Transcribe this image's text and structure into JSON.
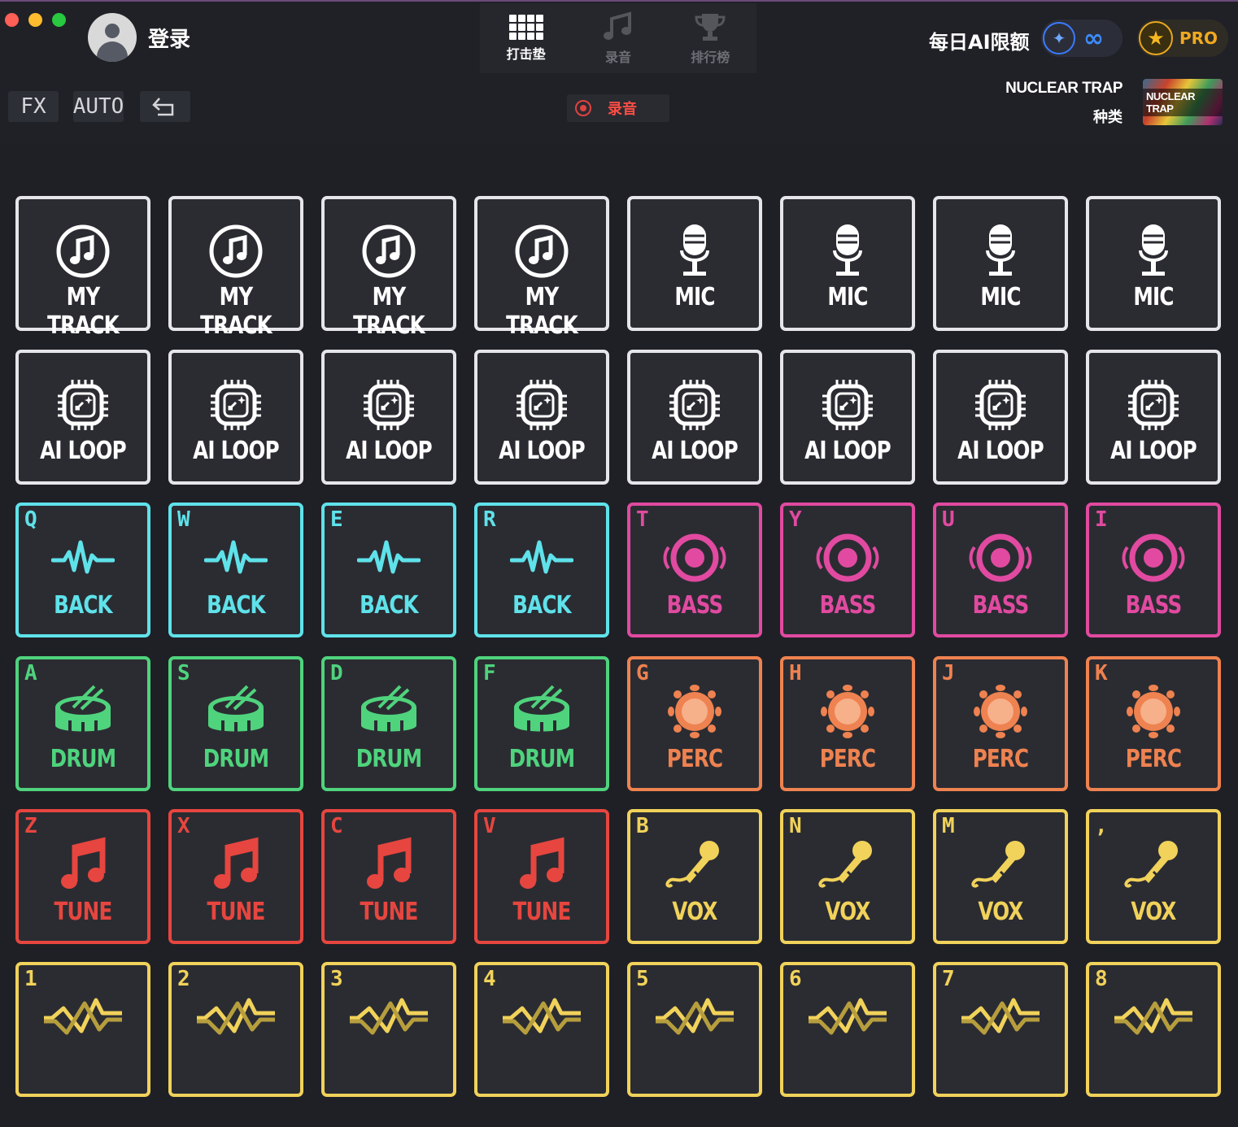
{
  "window": {
    "traffic_lights": [
      "#ff5f57",
      "#febc2e",
      "#28c840"
    ]
  },
  "user": {
    "login_label": "登录"
  },
  "nav": {
    "tabs": [
      {
        "label": "打击垫",
        "icon": "grid-icon",
        "active": true
      },
      {
        "label": "录音",
        "icon": "music-notes-icon",
        "active": false
      },
      {
        "label": "排行榜",
        "icon": "trophy-icon",
        "active": false
      }
    ]
  },
  "toolbar": {
    "fx_label": "FX",
    "auto_label": "AUTO",
    "undo_icon": "undo-icon"
  },
  "record": {
    "label": "录音"
  },
  "quota": {
    "label": "每日AI限额",
    "value": "∞"
  },
  "pro": {
    "label": "PRO"
  },
  "kit": {
    "name": "NUCLEAR TRAP",
    "type_label": "种类",
    "thumb_label": "NUCLEAR TRAP"
  },
  "colors": {
    "white": "#e6e6ea",
    "back": "#5fe2ea",
    "bass": "#e14aa0",
    "drum": "#4fd37d",
    "perc": "#ee8250",
    "tune": "#e6463f",
    "vox": "#f1d25a",
    "fx": "#f1d25a"
  },
  "rows": [
    {
      "type": "mytrack",
      "color": "white",
      "label": "MY TRACK",
      "keys": [
        "",
        "",
        "",
        "",
        "",
        "",
        "",
        ""
      ]
    },
    {
      "type": "mic",
      "color": "white",
      "label": "MIC",
      "keys": [
        "",
        "",
        "",
        "",
        "",
        "",
        "",
        ""
      ]
    },
    {
      "type": "ailoop",
      "color": "white",
      "label": "AI LOOP",
      "keys": [
        "",
        "",
        "",
        "",
        "",
        "",
        "",
        ""
      ]
    },
    {
      "type": "mixed1",
      "keys": [
        "Q",
        "W",
        "E",
        "R",
        "T",
        "Y",
        "U",
        "I"
      ]
    },
    {
      "type": "mixed2",
      "keys": [
        "A",
        "S",
        "D",
        "F",
        "G",
        "H",
        "J",
        "K"
      ]
    },
    {
      "type": "mixed3",
      "keys": [
        "Z",
        "X",
        "C",
        "V",
        "B",
        "N",
        "M",
        ","
      ]
    },
    {
      "type": "fx",
      "keys": [
        "1",
        "2",
        "3",
        "4",
        "5",
        "6",
        "7",
        "8"
      ]
    }
  ],
  "pad_groups": {
    "mytrack": {
      "label": "MY TRACK",
      "icon": "music-note-circle-icon"
    },
    "mic": {
      "label": "MIC",
      "icon": "microphone-icon"
    },
    "ailoop": {
      "label": "AI LOOP",
      "icon": "ai-chip-icon"
    },
    "back": {
      "label": "BACK",
      "icon": "waveform-icon"
    },
    "bass": {
      "label": "BASS",
      "icon": "speaker-icon"
    },
    "drum": {
      "label": "DRUM",
      "icon": "drum-icon"
    },
    "perc": {
      "label": "PERC",
      "icon": "tambourine-icon"
    },
    "tune": {
      "label": "TUNE",
      "icon": "music-note-icon"
    },
    "vox": {
      "label": "VOX",
      "icon": "handheld-mic-icon"
    },
    "fx": {
      "label": "",
      "icon": "fx-wave-icon"
    }
  }
}
